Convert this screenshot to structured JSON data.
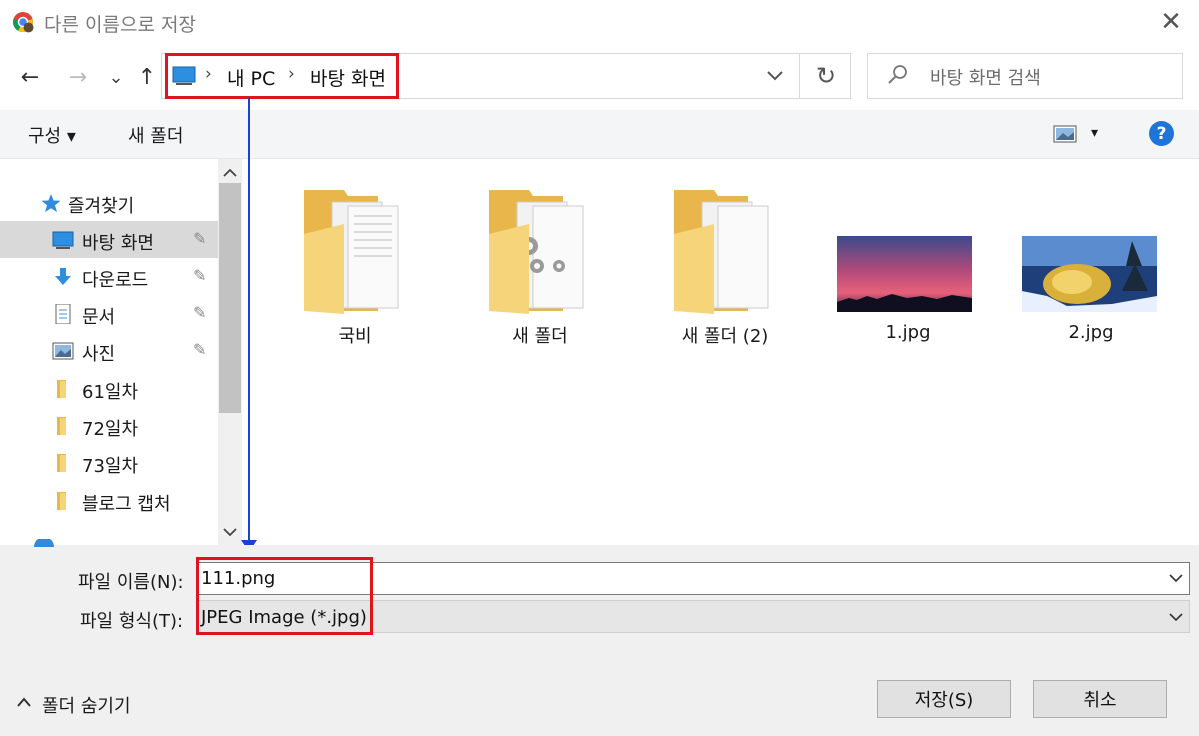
{
  "window": {
    "title": "다른 이름으로 저장",
    "close_glyph": "✕"
  },
  "nav": {
    "back": "←",
    "forward": "→",
    "recent": "⌄",
    "up": "↑",
    "refresh": "↻"
  },
  "address": {
    "breadcrumbs": [
      "내 PC",
      "바탕 화면"
    ],
    "separator": "›"
  },
  "search": {
    "placeholder": "바탕 화면 검색"
  },
  "toolbar": {
    "organize": "구성 ▾",
    "new_folder": "새 폴더",
    "view_dropdown": "▾",
    "help": "?"
  },
  "sidebar": {
    "quick_access": "즐겨찾기",
    "items": [
      {
        "label": "바탕 화면",
        "icon": "desktop-icon",
        "pinned": true
      },
      {
        "label": "다운로드",
        "icon": "download-icon",
        "pinned": true
      },
      {
        "label": "문서",
        "icon": "document-icon",
        "pinned": true
      },
      {
        "label": "사진",
        "icon": "pictures-icon",
        "pinned": true
      },
      {
        "label": "61일차",
        "icon": "folder-icon",
        "pinned": false
      },
      {
        "label": "72일차",
        "icon": "folder-icon",
        "pinned": false
      },
      {
        "label": "73일차",
        "icon": "folder-icon",
        "pinned": false
      },
      {
        "label": "블로그 캡처",
        "icon": "folder-icon",
        "pinned": false
      }
    ],
    "pin_glyph": "📌"
  },
  "files": [
    {
      "name": "국비",
      "type": "folder-docs"
    },
    {
      "name": "새 폴더",
      "type": "folder-gears"
    },
    {
      "name": "새 폴더 (2)",
      "type": "folder-blank"
    },
    {
      "name": "1.jpg",
      "type": "image-sunset"
    },
    {
      "name": "2.jpg",
      "type": "image-snow"
    }
  ],
  "form": {
    "filename_label": "파일 이름(N):",
    "filename_value": "111.png",
    "filetype_label": "파일 형식(T):",
    "filetype_value": "JPEG Image (*.jpg)",
    "dropdown_glyph": "⌵"
  },
  "footer": {
    "hide_folders": "폴더 숨기기",
    "hide_glyph": "⌃",
    "save": "저장(S)",
    "cancel": "취소"
  },
  "colors": {
    "highlight": "#e0141e",
    "arrow": "#1c3fd6",
    "accent": "#1f74d8",
    "selected": "#cce4f7"
  }
}
